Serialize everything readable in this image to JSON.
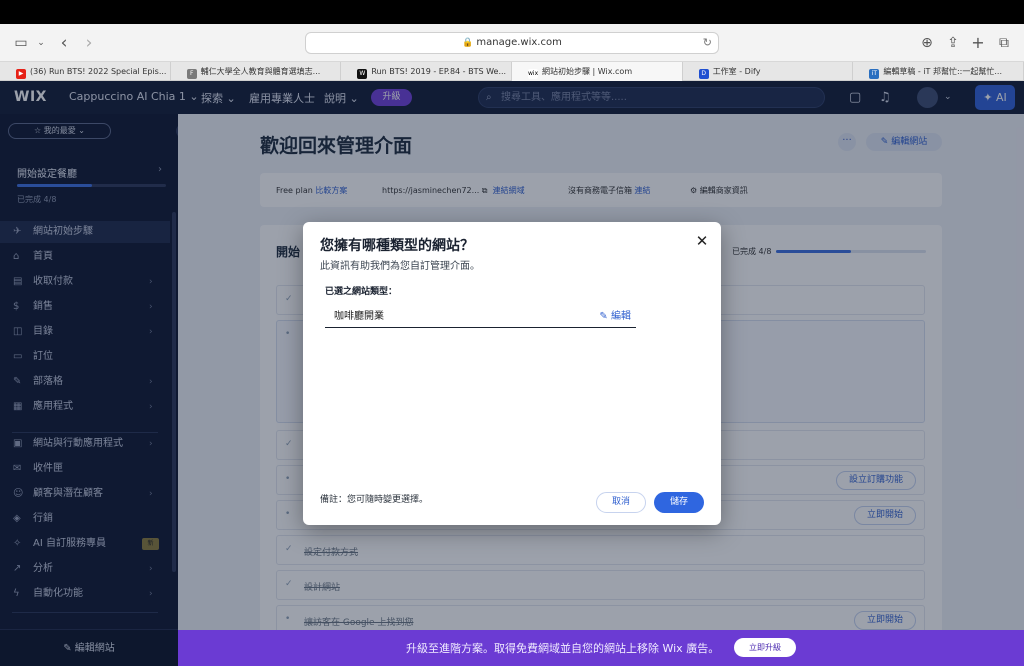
{
  "browser": {
    "url": "manage.wix.com",
    "tabs": [
      {
        "label": "(36) Run BTS! 2022 Special Epis...",
        "fav": "▶",
        "fav_color": "#e62117"
      },
      {
        "label": "輔仁大學全人教育與體育選填志...",
        "fav": "F",
        "fav_color": "#7a7a7a"
      },
      {
        "label": "Run BTS! 2019 - EP.84 - BTS We...",
        "fav": "W",
        "fav_color": "#111111"
      },
      {
        "label": "網站初始步驟 | Wix.com",
        "fav": "wix",
        "fav_color": "#ffffff"
      },
      {
        "label": "工作室 - Dify",
        "fav": "D",
        "fav_color": "#1f4fd1"
      },
      {
        "label": "編輯草稿 - iT 邦幫忙::一起幫忙...",
        "fav": "iT",
        "fav_color": "#2a6fc0"
      }
    ]
  },
  "wix_header": {
    "logo": "WIX",
    "site_name": "Cappuccino AI Chia 1",
    "explore": "探索",
    "hire": "雇用專業人士",
    "help": "說明",
    "upgrade": "升級",
    "search_placeholder": "搜尋工具、應用程式等等.....",
    "ai": "AI"
  },
  "sidebar": {
    "favorites": "我的最愛",
    "setup_title": "開始設定餐廳",
    "setup_progress": "已完成 4/8",
    "items": [
      {
        "label": "網站初始步驟",
        "icon": "rocket-icon",
        "glyph": "✈"
      },
      {
        "label": "首頁",
        "icon": "home-icon",
        "glyph": "⌂"
      },
      {
        "label": "收取付款",
        "icon": "payment-icon",
        "glyph": "▤"
      },
      {
        "label": "銷售",
        "icon": "dollar-icon",
        "glyph": "$"
      },
      {
        "label": "目錄",
        "icon": "catalog-icon",
        "glyph": "◫"
      },
      {
        "label": "訂位",
        "icon": "reservation-icon",
        "glyph": "▭"
      },
      {
        "label": "部落格",
        "icon": "blog-icon",
        "glyph": "✎"
      },
      {
        "label": "應用程式",
        "icon": "apps-icon",
        "glyph": "▦"
      },
      {
        "label": "網站與行動應用程式",
        "icon": "devices-icon",
        "glyph": "▣"
      },
      {
        "label": "收件匣",
        "icon": "inbox-icon",
        "glyph": "✉"
      },
      {
        "label": "顧客與潛在顧客",
        "icon": "customers-icon",
        "glyph": "☺"
      },
      {
        "label": "行銷",
        "icon": "marketing-icon",
        "glyph": "◈"
      },
      {
        "label": "AI 自訂服務專員",
        "icon": "ai-agent-icon",
        "glyph": "✧",
        "badge": "新"
      },
      {
        "label": "分析",
        "icon": "analytics-icon",
        "glyph": "↗"
      },
      {
        "label": "自動化功能",
        "icon": "automation-icon",
        "glyph": "ϟ"
      }
    ],
    "edit_site": "編輯網站"
  },
  "main": {
    "welcome": "歡迎回來管理介面",
    "edit_site": "編輯網站",
    "plan": "Free plan",
    "compare_plans": "比較方案",
    "site_url": "https://jasminechen72...",
    "connect_domain": "連結網域",
    "no_email": "沒有商務電子信箱",
    "connect": "連結",
    "edit_business": "編輯商家資訊",
    "card_title": "開始",
    "card_progress": "已完成 4/8",
    "steps": [
      {
        "text": "",
        "done": true,
        "button": ""
      },
      {
        "text": "",
        "done": false,
        "button": "",
        "open": true
      },
      {
        "text": "",
        "done": true,
        "button": ""
      },
      {
        "text": "",
        "done": false,
        "button": "設立訂購功能"
      },
      {
        "text": "",
        "done": false,
        "button": "立即開始"
      },
      {
        "text": "設定付款方式",
        "done": true,
        "button": ""
      },
      {
        "text": "設計網站",
        "done": true,
        "button": ""
      },
      {
        "text": "讓訪客在 Google 上找到您",
        "done": false,
        "button": "立即開始"
      }
    ]
  },
  "upgrade_bar": {
    "text": "升級至進階方案。取得免費網域並自您的網站上移除 Wix 廣告。",
    "button": "立即升級"
  },
  "modal": {
    "title": "您擁有哪種類型的網站？",
    "subtitle": "此資訊有助我們為您自訂管理介面。",
    "selected_label": "已選之網站類型：",
    "selected_value": "咖啡廳開業",
    "edit": "編輯",
    "note": "備註：您可隨時變更選擇。",
    "cancel": "取消",
    "save": "儲存"
  }
}
